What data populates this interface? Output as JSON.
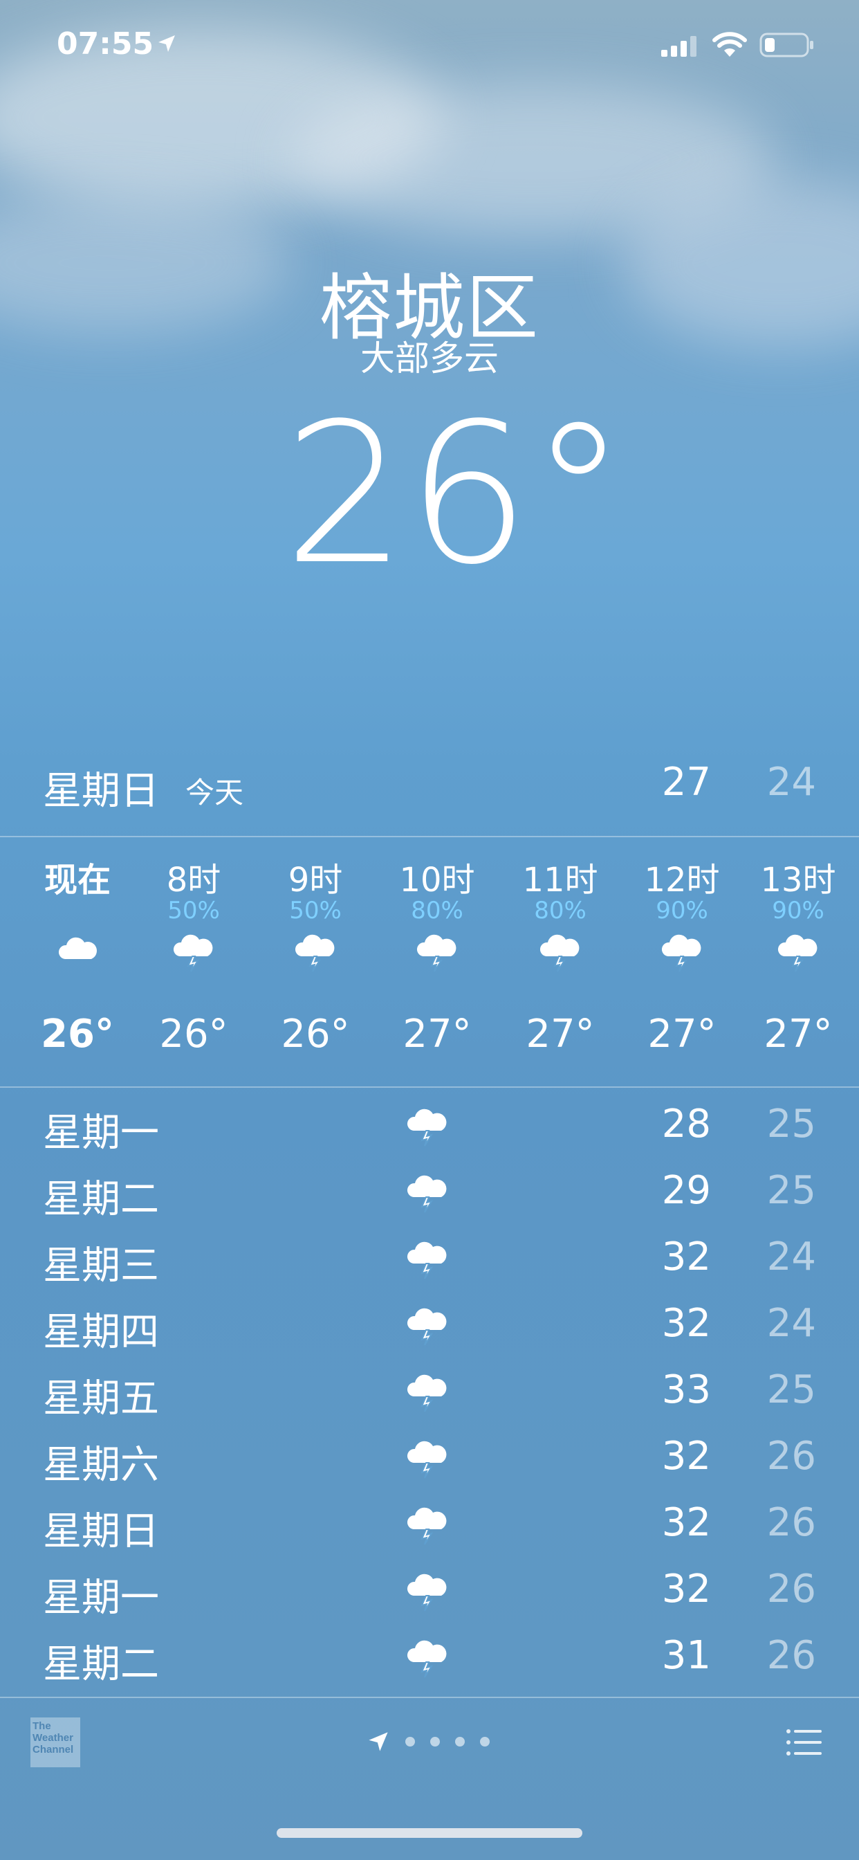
{
  "status_bar": {
    "time": "07:55",
    "location_icon": "location-arrow-icon",
    "signal_icon": "cellular-signal-icon",
    "wifi_icon": "wifi-icon",
    "battery_icon": "battery-icon"
  },
  "location": {
    "city": "榕城区",
    "condition": "大部多云",
    "temperature": "26°"
  },
  "today": {
    "day": "星期日",
    "tag": "今天",
    "high": "27",
    "low": "24"
  },
  "hourly": [
    {
      "label": "现在",
      "precip": "",
      "icon": "cloud-icon",
      "temp": "26°"
    },
    {
      "label": "8时",
      "precip": "50%",
      "icon": "thunderstorm-icon",
      "temp": "26°"
    },
    {
      "label": "9时",
      "precip": "50%",
      "icon": "thunderstorm-icon",
      "temp": "26°"
    },
    {
      "label": "10时",
      "precip": "80%",
      "icon": "thunderstorm-icon",
      "temp": "27°"
    },
    {
      "label": "11时",
      "precip": "80%",
      "icon": "thunderstorm-icon",
      "temp": "27°"
    },
    {
      "label": "12时",
      "precip": "90%",
      "icon": "thunderstorm-icon",
      "temp": "27°"
    },
    {
      "label": "13时",
      "precip": "90%",
      "icon": "thunderstorm-icon",
      "temp": "27°"
    }
  ],
  "daily": [
    {
      "day": "星期一",
      "icon": "thunderstorm-icon",
      "high": "28",
      "low": "25"
    },
    {
      "day": "星期二",
      "icon": "thunderstorm-icon",
      "high": "29",
      "low": "25"
    },
    {
      "day": "星期三",
      "icon": "thunderstorm-icon",
      "high": "32",
      "low": "24"
    },
    {
      "day": "星期四",
      "icon": "thunderstorm-icon",
      "high": "32",
      "low": "24"
    },
    {
      "day": "星期五",
      "icon": "thunderstorm-icon",
      "high": "33",
      "low": "25"
    },
    {
      "day": "星期六",
      "icon": "thunderstorm-icon",
      "high": "32",
      "low": "26"
    },
    {
      "day": "星期日",
      "icon": "thunderstorm-icon",
      "high": "32",
      "low": "26"
    },
    {
      "day": "星期一",
      "icon": "thunderstorm-icon",
      "high": "32",
      "low": "26"
    },
    {
      "day": "星期二",
      "icon": "thunderstorm-icon",
      "high": "31",
      "low": "26"
    }
  ],
  "bottom_bar": {
    "logo_text": "The Weather Channel",
    "location_page_icon": "location-arrow-icon",
    "list_icon": "list-icon"
  },
  "colors": {
    "precip_blue": "#7fd0ff",
    "sky_blue": "#5f9fcf"
  }
}
